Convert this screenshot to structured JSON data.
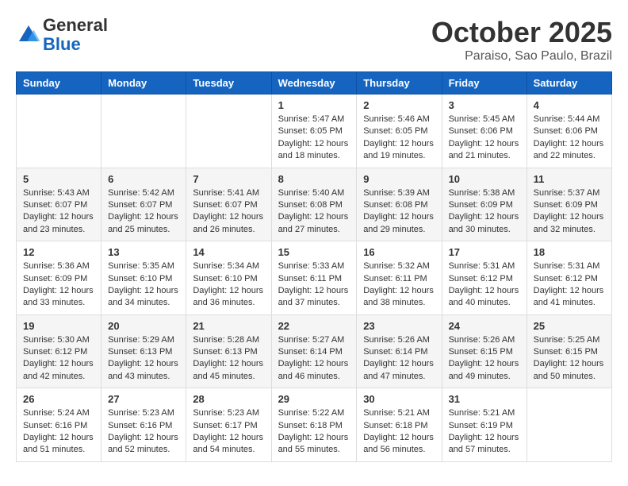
{
  "header": {
    "logo_general": "General",
    "logo_blue": "Blue",
    "month_title": "October 2025",
    "location": "Paraiso, Sao Paulo, Brazil"
  },
  "days_of_week": [
    "Sunday",
    "Monday",
    "Tuesday",
    "Wednesday",
    "Thursday",
    "Friday",
    "Saturday"
  ],
  "weeks": [
    [
      {
        "day": "",
        "info": ""
      },
      {
        "day": "",
        "info": ""
      },
      {
        "day": "",
        "info": ""
      },
      {
        "day": "1",
        "info": "Sunrise: 5:47 AM\nSunset: 6:05 PM\nDaylight: 12 hours and 18 minutes."
      },
      {
        "day": "2",
        "info": "Sunrise: 5:46 AM\nSunset: 6:05 PM\nDaylight: 12 hours and 19 minutes."
      },
      {
        "day": "3",
        "info": "Sunrise: 5:45 AM\nSunset: 6:06 PM\nDaylight: 12 hours and 21 minutes."
      },
      {
        "day": "4",
        "info": "Sunrise: 5:44 AM\nSunset: 6:06 PM\nDaylight: 12 hours and 22 minutes."
      }
    ],
    [
      {
        "day": "5",
        "info": "Sunrise: 5:43 AM\nSunset: 6:07 PM\nDaylight: 12 hours and 23 minutes."
      },
      {
        "day": "6",
        "info": "Sunrise: 5:42 AM\nSunset: 6:07 PM\nDaylight: 12 hours and 25 minutes."
      },
      {
        "day": "7",
        "info": "Sunrise: 5:41 AM\nSunset: 6:07 PM\nDaylight: 12 hours and 26 minutes."
      },
      {
        "day": "8",
        "info": "Sunrise: 5:40 AM\nSunset: 6:08 PM\nDaylight: 12 hours and 27 minutes."
      },
      {
        "day": "9",
        "info": "Sunrise: 5:39 AM\nSunset: 6:08 PM\nDaylight: 12 hours and 29 minutes."
      },
      {
        "day": "10",
        "info": "Sunrise: 5:38 AM\nSunset: 6:09 PM\nDaylight: 12 hours and 30 minutes."
      },
      {
        "day": "11",
        "info": "Sunrise: 5:37 AM\nSunset: 6:09 PM\nDaylight: 12 hours and 32 minutes."
      }
    ],
    [
      {
        "day": "12",
        "info": "Sunrise: 5:36 AM\nSunset: 6:09 PM\nDaylight: 12 hours and 33 minutes."
      },
      {
        "day": "13",
        "info": "Sunrise: 5:35 AM\nSunset: 6:10 PM\nDaylight: 12 hours and 34 minutes."
      },
      {
        "day": "14",
        "info": "Sunrise: 5:34 AM\nSunset: 6:10 PM\nDaylight: 12 hours and 36 minutes."
      },
      {
        "day": "15",
        "info": "Sunrise: 5:33 AM\nSunset: 6:11 PM\nDaylight: 12 hours and 37 minutes."
      },
      {
        "day": "16",
        "info": "Sunrise: 5:32 AM\nSunset: 6:11 PM\nDaylight: 12 hours and 38 minutes."
      },
      {
        "day": "17",
        "info": "Sunrise: 5:31 AM\nSunset: 6:12 PM\nDaylight: 12 hours and 40 minutes."
      },
      {
        "day": "18",
        "info": "Sunrise: 5:31 AM\nSunset: 6:12 PM\nDaylight: 12 hours and 41 minutes."
      }
    ],
    [
      {
        "day": "19",
        "info": "Sunrise: 5:30 AM\nSunset: 6:12 PM\nDaylight: 12 hours and 42 minutes."
      },
      {
        "day": "20",
        "info": "Sunrise: 5:29 AM\nSunset: 6:13 PM\nDaylight: 12 hours and 43 minutes."
      },
      {
        "day": "21",
        "info": "Sunrise: 5:28 AM\nSunset: 6:13 PM\nDaylight: 12 hours and 45 minutes."
      },
      {
        "day": "22",
        "info": "Sunrise: 5:27 AM\nSunset: 6:14 PM\nDaylight: 12 hours and 46 minutes."
      },
      {
        "day": "23",
        "info": "Sunrise: 5:26 AM\nSunset: 6:14 PM\nDaylight: 12 hours and 47 minutes."
      },
      {
        "day": "24",
        "info": "Sunrise: 5:26 AM\nSunset: 6:15 PM\nDaylight: 12 hours and 49 minutes."
      },
      {
        "day": "25",
        "info": "Sunrise: 5:25 AM\nSunset: 6:15 PM\nDaylight: 12 hours and 50 minutes."
      }
    ],
    [
      {
        "day": "26",
        "info": "Sunrise: 5:24 AM\nSunset: 6:16 PM\nDaylight: 12 hours and 51 minutes."
      },
      {
        "day": "27",
        "info": "Sunrise: 5:23 AM\nSunset: 6:16 PM\nDaylight: 12 hours and 52 minutes."
      },
      {
        "day": "28",
        "info": "Sunrise: 5:23 AM\nSunset: 6:17 PM\nDaylight: 12 hours and 54 minutes."
      },
      {
        "day": "29",
        "info": "Sunrise: 5:22 AM\nSunset: 6:18 PM\nDaylight: 12 hours and 55 minutes."
      },
      {
        "day": "30",
        "info": "Sunrise: 5:21 AM\nSunset: 6:18 PM\nDaylight: 12 hours and 56 minutes."
      },
      {
        "day": "31",
        "info": "Sunrise: 5:21 AM\nSunset: 6:19 PM\nDaylight: 12 hours and 57 minutes."
      },
      {
        "day": "",
        "info": ""
      }
    ]
  ]
}
